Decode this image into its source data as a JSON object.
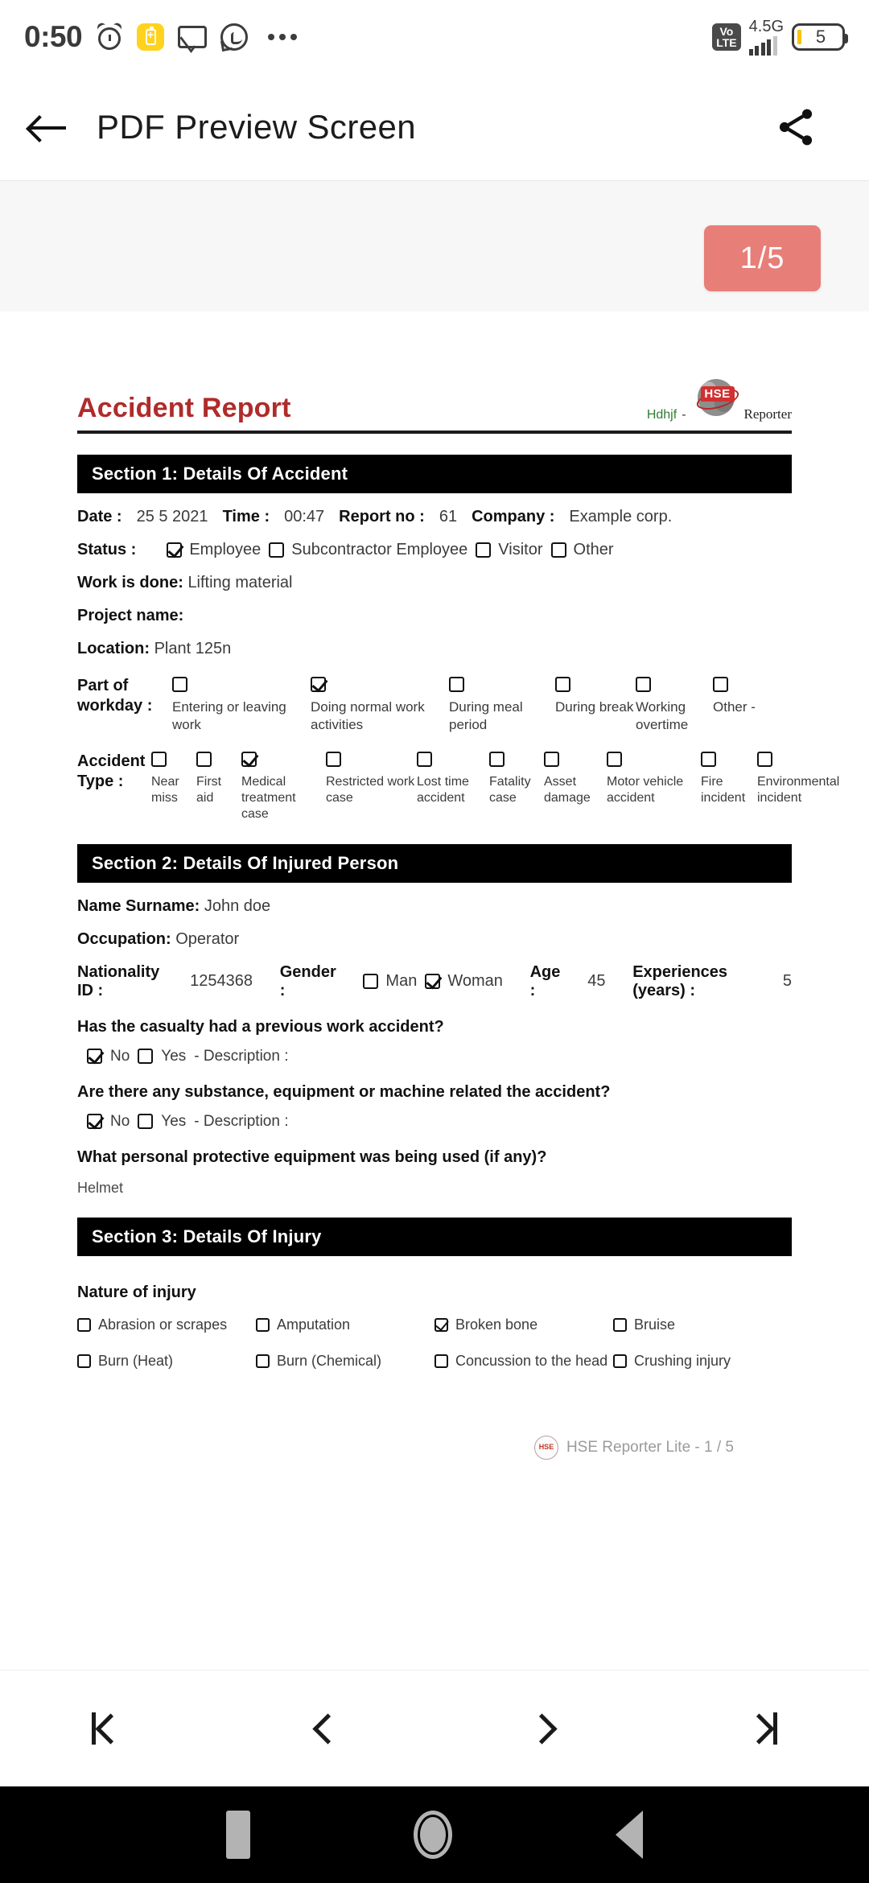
{
  "status_bar": {
    "clock": "0:50",
    "icons": [
      "alarm-icon",
      "battery-saver-icon",
      "mail-icon",
      "whatsapp-icon",
      "more-dots-icon"
    ],
    "volte": {
      "line1": "Vo",
      "line2": "LTE"
    },
    "network": "4.5G",
    "battery_percent": "5"
  },
  "app_bar": {
    "back_label": "back-arrow",
    "title": "PDF Preview Screen",
    "share_label": "share"
  },
  "viewer": {
    "page_badge": "1/5"
  },
  "document": {
    "title": "Accident Report",
    "brand": {
      "name": "Hdhjf",
      "dash": "-",
      "logo_text": "HSE",
      "reporter": "Reporter"
    },
    "section1": {
      "heading": "Section 1: Details Of Accident",
      "date_label": "Date :",
      "date_value": "25 5 2021",
      "time_label": "Time :",
      "time_value": "00:47",
      "report_no_label": "Report no :",
      "report_no_value": "61",
      "company_label": "Company :",
      "company_value": "Example corp.",
      "status_label": "Status :",
      "status_options": [
        {
          "label": "Employee",
          "checked": true
        },
        {
          "label": "Subcontractor Employee",
          "checked": false
        },
        {
          "label": "Visitor",
          "checked": false
        },
        {
          "label": "Other",
          "checked": false
        }
      ],
      "work_done_label": "Work is done:",
      "work_done_value": "Lifting material",
      "project_name_label": "Project name:",
      "project_name_value": "",
      "location_label": "Location:",
      "location_value": "Plant 125n",
      "workday_label_line1": "Part of",
      "workday_label_line2": "workday :",
      "workday_options": [
        {
          "label": "Entering or leaving work",
          "checked": false
        },
        {
          "label": "Doing normal work activities",
          "checked": true
        },
        {
          "label": "During meal period",
          "checked": false
        },
        {
          "label": "During break",
          "checked": false
        },
        {
          "label": "Working overtime",
          "checked": false
        },
        {
          "label": "Other -",
          "checked": false
        }
      ],
      "accident_type_label_line1": "Accident",
      "accident_type_label_line2": "Type :",
      "accident_type_options": [
        {
          "label": "Near miss",
          "checked": false
        },
        {
          "label": "First aid",
          "checked": false
        },
        {
          "label": "Medical treatment case",
          "checked": true
        },
        {
          "label": "Restricted work case",
          "checked": false
        },
        {
          "label": "Lost time accident",
          "checked": false
        },
        {
          "label": "Fatality case",
          "checked": false
        },
        {
          "label": "Asset damage",
          "checked": false
        },
        {
          "label": "Motor vehicle accident",
          "checked": false
        },
        {
          "label": "Fire incident",
          "checked": false
        },
        {
          "label": "Environmental incident",
          "checked": false
        }
      ]
    },
    "section2": {
      "heading": "Section 2: Details Of Injured Person",
      "name_label": "Name Surname:",
      "name_value": "John doe",
      "occupation_label": "Occupation:",
      "occupation_value": "Operator",
      "nationality_label": "Nationality ID :",
      "nationality_value": "1254368",
      "gender_label": "Gender :",
      "gender_options": [
        {
          "label": "Man",
          "checked": false
        },
        {
          "label": "Woman",
          "checked": true
        }
      ],
      "age_label": "Age :",
      "age_value": "45",
      "experience_label": "Experiences (years) :",
      "experience_value": "5",
      "q1": "Has the casualty had a previous work accident?",
      "q1_no": "No",
      "q1_yes": "Yes",
      "q1_desc": "- Description :",
      "q1_no_checked": true,
      "q2": "Are there any substance, equipment or machine related the accident?",
      "q2_no": "No",
      "q2_yes": "Yes",
      "q2_desc": "- Description :",
      "q2_no_checked": true,
      "q3": "What personal protective equipment was being used (if any)?",
      "q3_answer": "Helmet"
    },
    "section3": {
      "heading": "Section 3: Details Of Injury",
      "nature_label": "Nature of injury",
      "injuries": [
        {
          "label": "Abrasion or scrapes",
          "checked": false
        },
        {
          "label": "Amputation",
          "checked": false
        },
        {
          "label": "Broken bone",
          "checked": true
        },
        {
          "label": "Bruise",
          "checked": false
        },
        {
          "label": "Burn (Heat)",
          "checked": false
        },
        {
          "label": "Burn (Chemical)",
          "checked": false
        },
        {
          "label": "Concussion to the head",
          "checked": false
        },
        {
          "label": "Crushing injury",
          "checked": false
        }
      ]
    },
    "footer": "HSE Reporter Lite - 1 / 5"
  },
  "pager": {
    "first": "first-page",
    "prev": "previous-page",
    "next": "next-page",
    "last": "last-page"
  },
  "android_nav": {
    "recents": "recents",
    "home": "home",
    "back": "back"
  },
  "colors": {
    "accent_badge": "#E87E78",
    "doc_title": "#B02B2B",
    "section_bar": "#000000",
    "brand_green": "#2E7D32",
    "battery_fill": "#FFC107"
  }
}
